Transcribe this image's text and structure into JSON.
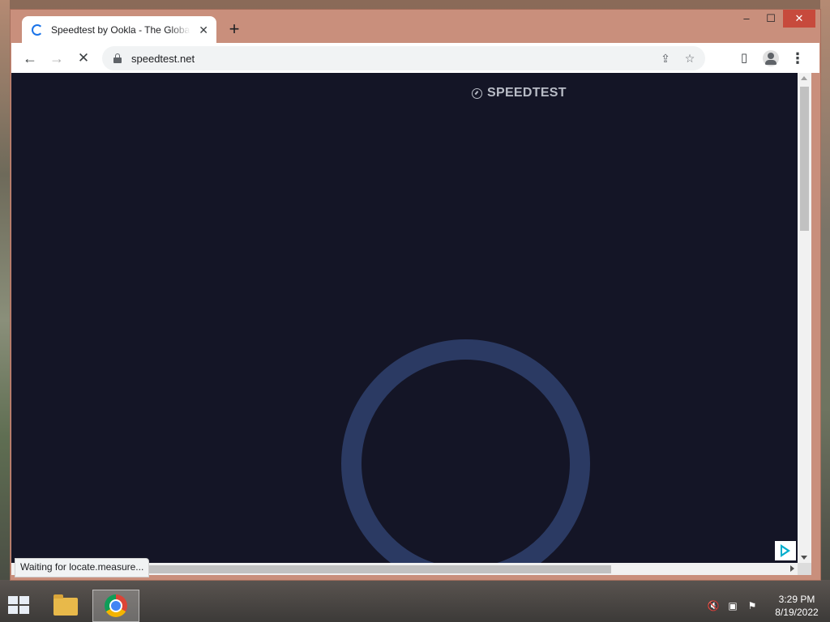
{
  "window": {
    "tab_title": "Speedtest by Ookla - The Global Broadband Speed Test",
    "tab_close": "✕",
    "new_tab": "+",
    "controls": {
      "minimize": "–",
      "maximize": "☐",
      "close": "✕"
    }
  },
  "toolbar": {
    "back": "←",
    "forward": "→",
    "stop": "✕",
    "url": "speedtest.net",
    "share": "⇪",
    "bookmark": "☆",
    "side_panel": "▯",
    "menu": "⋮"
  },
  "page": {
    "brand": "SPEEDTEST",
    "colors": {
      "background": "#141526",
      "ring": "#2b3a63",
      "brand_text": "#b8bcc6"
    }
  },
  "status": {
    "text": "Waiting for locate.measure..."
  },
  "taskbar": {
    "time": "3:29 PM",
    "date": "8/19/2022",
    "tray": {
      "volume": "🔇",
      "network": "▣",
      "flag": "⚑"
    }
  }
}
